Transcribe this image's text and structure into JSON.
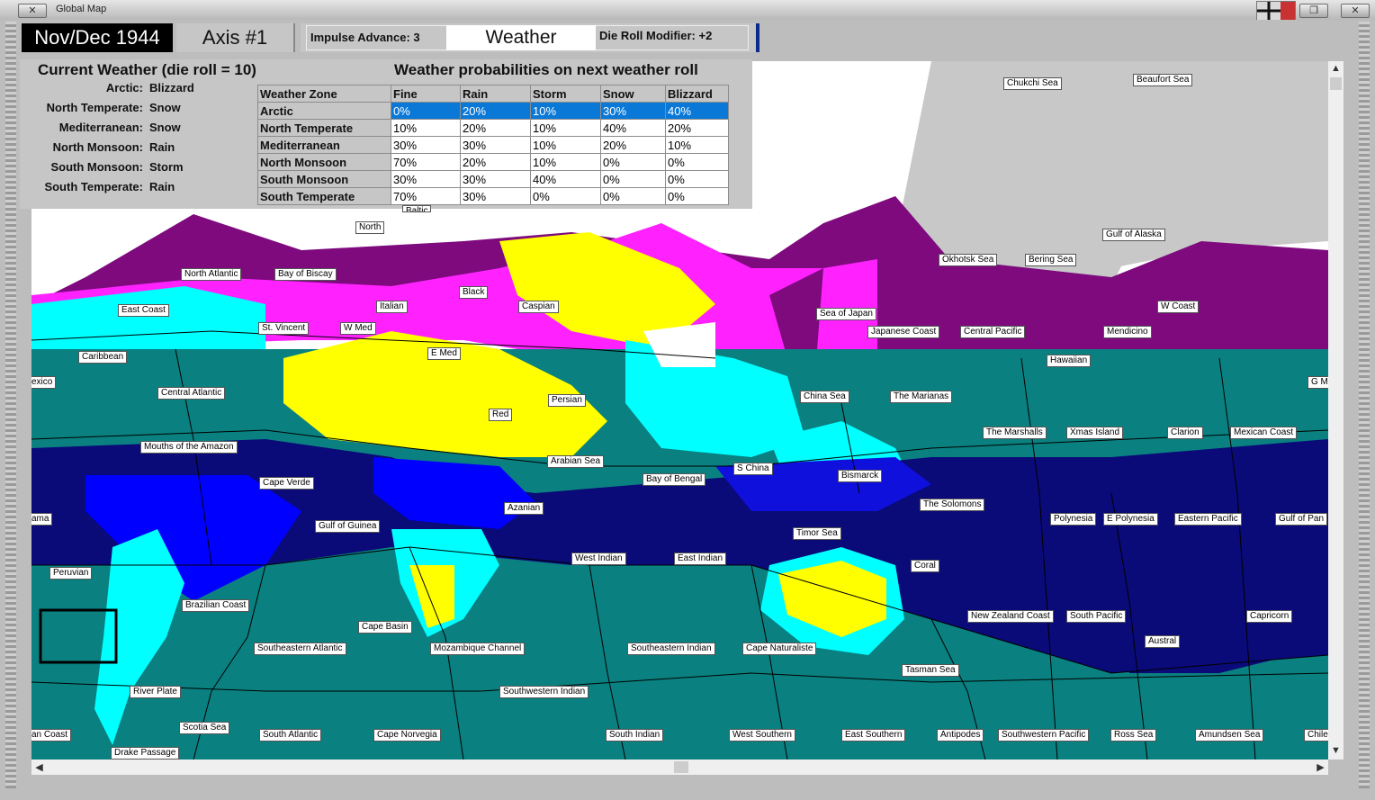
{
  "window": {
    "title": "Global Map"
  },
  "header": {
    "date": "Nov/Dec 1944",
    "side": "Axis #1",
    "impulse_label": "Impulse Advance:",
    "impulse_value": "3",
    "phase": "Weather",
    "drm_label": "Die Roll Modifier:",
    "drm_value": "+2"
  },
  "current_weather": {
    "title": "Current Weather (die roll = 10)",
    "zones": [
      {
        "label": "Arctic:",
        "value": "Blizzard"
      },
      {
        "label": "North Temperate:",
        "value": "Snow"
      },
      {
        "label": "Mediterranean:",
        "value": "Snow"
      },
      {
        "label": "North Monsoon:",
        "value": "Rain"
      },
      {
        "label": "South Monsoon:",
        "value": "Storm"
      },
      {
        "label": "South Temperate:",
        "value": "Rain"
      }
    ]
  },
  "probabilities": {
    "title": "Weather probabilities on next weather roll",
    "headers": [
      "Weather Zone",
      "Fine",
      "Rain",
      "Storm",
      "Snow",
      "Blizzard"
    ],
    "rows": [
      [
        "Arctic",
        "0%",
        "20%",
        "10%",
        "30%",
        "40%"
      ],
      [
        "North Temperate",
        "10%",
        "20%",
        "10%",
        "40%",
        "20%"
      ],
      [
        "Mediterranean",
        "30%",
        "30%",
        "10%",
        "20%",
        "10%"
      ],
      [
        "North Monsoon",
        "70%",
        "20%",
        "10%",
        "0%",
        "0%"
      ],
      [
        "South Monsoon",
        "30%",
        "30%",
        "40%",
        "0%",
        "0%"
      ],
      [
        "South Temperate",
        "70%",
        "30%",
        "0%",
        "0%",
        "0%"
      ]
    ]
  },
  "sea_labels": [
    "Chukchi Sea",
    "Beaufort Sea",
    "North",
    "Gulf of Alaska",
    "Okhotsk Sea",
    "Bering Sea",
    "North Atlantic",
    "Bay of Biscay",
    "Black",
    "Caspian",
    "Italian",
    "East Coast",
    "Sea of Japan",
    "W Coast",
    "St. Vincent",
    "W Med",
    "Japanese Coast",
    "Central Pacific",
    "Mendicino",
    "E Med",
    "Caribbean",
    "Hawaiian",
    "exico",
    "Central Atlantic",
    "China Sea",
    "The Marianas",
    "Persian",
    "G M",
    "Red",
    "The Marshalls",
    "Xmas Island",
    "Clarion",
    "Mexican Coast",
    "Mouths of the Amazon",
    "Arabian Sea",
    "S China",
    "Bismarck",
    "Cape Verde",
    "Bay of Bengal",
    "The Solomons",
    "Azanian",
    "ama",
    "Polynesia",
    "E Polynesia",
    "Eastern Pacific",
    "Gulf of Pan",
    "Gulf of Guinea",
    "Timor Sea",
    "Peruvian",
    "West Indian",
    "East Indian",
    "Coral",
    "Brazilian Coast",
    "New Zealand Coast",
    "South Pacific",
    "Capricorn",
    "Cape Basin",
    "Austral",
    "Southeastern Atlantic",
    "Mozambique Channel",
    "Southeastern Indian",
    "Cape Naturaliste",
    "Tasman Sea",
    "River Plate",
    "Southwestern Indian",
    "Scotia Sea",
    "an Coast",
    "South Atlantic",
    "Cape Norvegia",
    "South Indian",
    "West Southern",
    "East Southern",
    "Antipodes",
    "Southwestern Pacific",
    "Ross Sea",
    "Amundsen Sea",
    "Chile",
    "Drake Passage",
    "Baltic"
  ],
  "colors": {
    "arctic_white": "#ffffff",
    "polar_grey": "#c8c8c8",
    "north_temperate": "#7e0a7e",
    "mediterranean": "#ff22ff",
    "north_monsoon": "#ffff00",
    "ocean_teal": "#0a8080",
    "monsoon_cyan": "#00ffff",
    "south_monsoon": "#0000cc",
    "deep_blue": "#0a0a78",
    "selected_row": "#0a78d7"
  },
  "icons": [
    "close-icon",
    "restore-icon",
    "flag-icon",
    "scroll-up-icon",
    "scroll-down-icon",
    "scroll-left-icon",
    "scroll-right-icon"
  ]
}
